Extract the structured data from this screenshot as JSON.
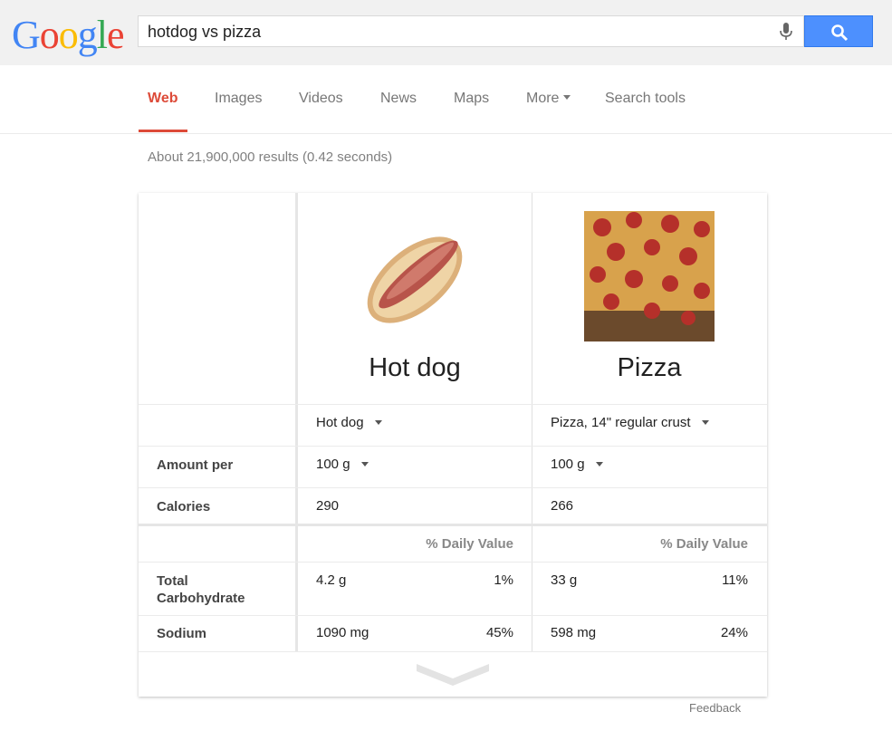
{
  "header": {
    "logo_letters": [
      {
        "char": "G",
        "color": "#4285f4"
      },
      {
        "char": "o",
        "color": "#ea4335"
      },
      {
        "char": "o",
        "color": "#fbbc05"
      },
      {
        "char": "g",
        "color": "#4285f4"
      },
      {
        "char": "l",
        "color": "#34a853"
      },
      {
        "char": "e",
        "color": "#ea4335"
      }
    ],
    "query": "hotdog vs pizza",
    "mic_icon": "microphone-icon",
    "search_icon": "magnifier-icon"
  },
  "nav": {
    "tabs": [
      "Web",
      "Images",
      "Videos",
      "News",
      "Maps",
      "More",
      "Search tools"
    ],
    "active_tab": "Web",
    "accent_color": "#dd4b39"
  },
  "results_stats": "About 21,900,000 results (0.42 seconds)",
  "comparison": {
    "foods": [
      {
        "name": "Hot dog",
        "variant": "Hot dog",
        "amount": "100 g",
        "calories": "290",
        "carbs": "4.2 g",
        "carbs_dv": "1%",
        "sodium": "1090 mg",
        "sodium_dv": "45%"
      },
      {
        "name": "Pizza",
        "variant": "Pizza, 14\" regular crust",
        "amount": "100 g",
        "calories": "266",
        "carbs": "33 g",
        "carbs_dv": "11%",
        "sodium": "598 mg",
        "sodium_dv": "24%"
      }
    ],
    "labels": {
      "amount_per": "Amount per",
      "calories": "Calories",
      "daily_value": "% Daily Value",
      "carbs": "Total Carbohydrate",
      "sodium": "Sodium"
    },
    "expand_icon": "chevron-down-icon"
  },
  "feedback": "Feedback"
}
